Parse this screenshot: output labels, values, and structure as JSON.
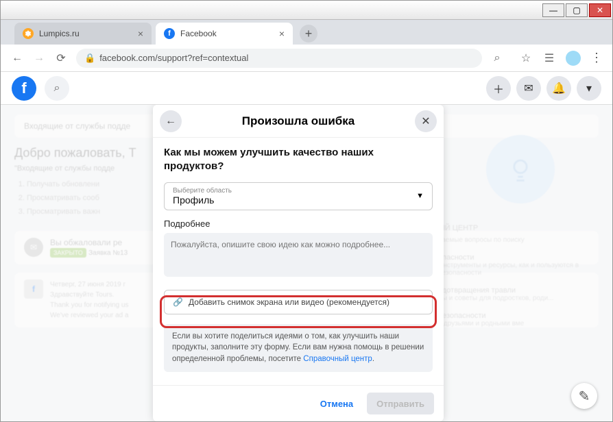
{
  "window": {
    "min": "—",
    "max": "▢",
    "close": "✕"
  },
  "tabs": {
    "lumpics": "Lumpics.ru",
    "facebook": "Facebook",
    "plus": "+"
  },
  "addr": {
    "url": "facebook.com/support?ref=contextual"
  },
  "modal": {
    "title": "Произошла ошибка",
    "question": "Как мы можем улучшить качество наших продуктов?",
    "select_label": "Выберите область",
    "select_value": "Профиль",
    "details_label": "Подробнее",
    "details_placeholder": "Пожалуйста, опишите свою идею как можно подробнее...",
    "attach_text": "Добавить снимок экрана или видео (рекомендуется)",
    "info_text": "Если вы хотите поделиться идеями о том, как улучшить наши продукты, заполните эту форму. Если вам нужна помощь в решении определенной проблемы, посетите ",
    "info_link": "Справочный центр",
    "cancel": "Отмена",
    "submit": "Отправить"
  },
  "bg": {
    "inbox": "Входящие от службы подде",
    "welcome": "Добро пожаловать, T",
    "welcome_sub": "\"Входящие от службы подде",
    "li1": "Получать обновлени",
    "li2": "Просматривать сооб",
    "li3": "Просматривать важн",
    "appeal": "Вы обжаловали ре",
    "closed": "ЗАКРЫТО",
    "ticket": "Заявка №13",
    "date": "Четверг, 27 июня 2019 г",
    "hi": "Здравствуйте Tours.",
    "thx": "Thank you for notifying us",
    "rev": "We've reviewed your ad a",
    "right_center": "ЫЙ ЦЕНТР",
    "r_search": "ваемые вопросы по поиску",
    "r_sec_head": "опасности",
    "r_sec_txt": "Инструменты и ресурсы, как и пользуются в безопасности",
    "r_bul_head": "едотвращения травли",
    "r_bul_txt": "лы и советы для подростков, роди...",
    "r_safe_head": "безопасности",
    "r_safe_txt": "с друзьями и родными вме"
  }
}
